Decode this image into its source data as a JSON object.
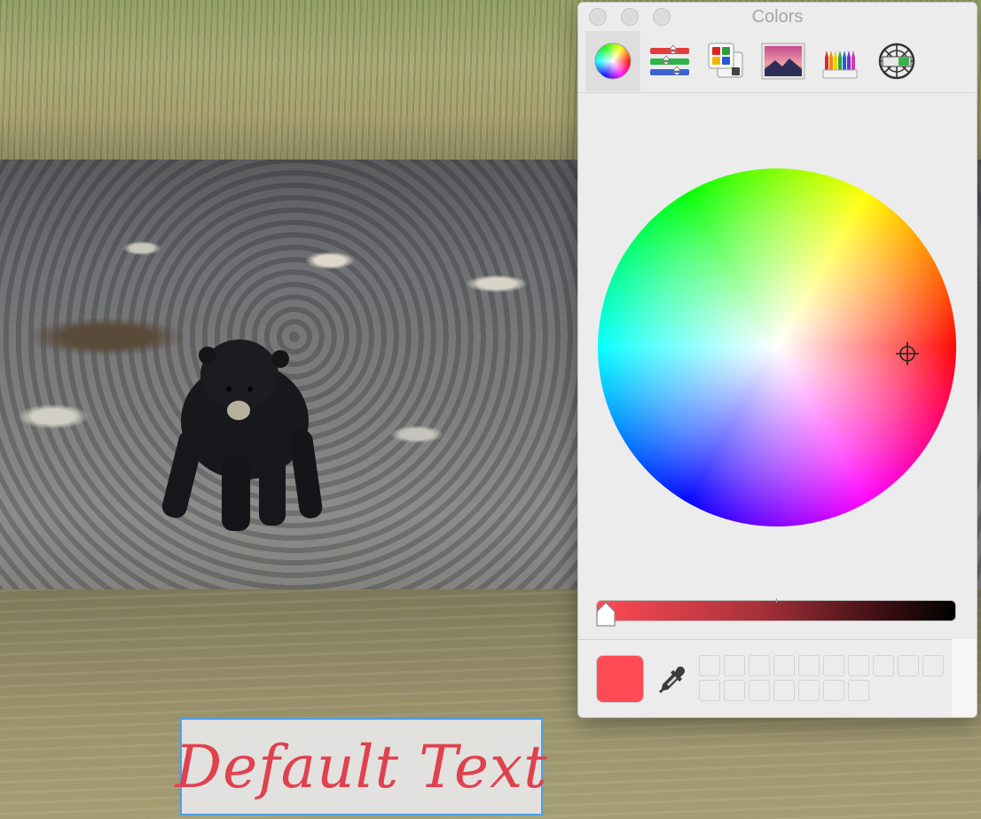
{
  "panel": {
    "title": "Colors",
    "modes": [
      {
        "name": "color-wheel",
        "active": true
      },
      {
        "name": "color-sliders",
        "active": false
      },
      {
        "name": "color-palettes",
        "active": false
      },
      {
        "name": "image-palettes",
        "active": false
      },
      {
        "name": "pencils",
        "active": false
      },
      {
        "name": "custom-palette",
        "active": false
      }
    ],
    "brightness": 1.0,
    "current_color": "#ff4b55",
    "swatch_count": 17
  },
  "textbox": {
    "text": "Default Text",
    "color": "#e0414f"
  }
}
